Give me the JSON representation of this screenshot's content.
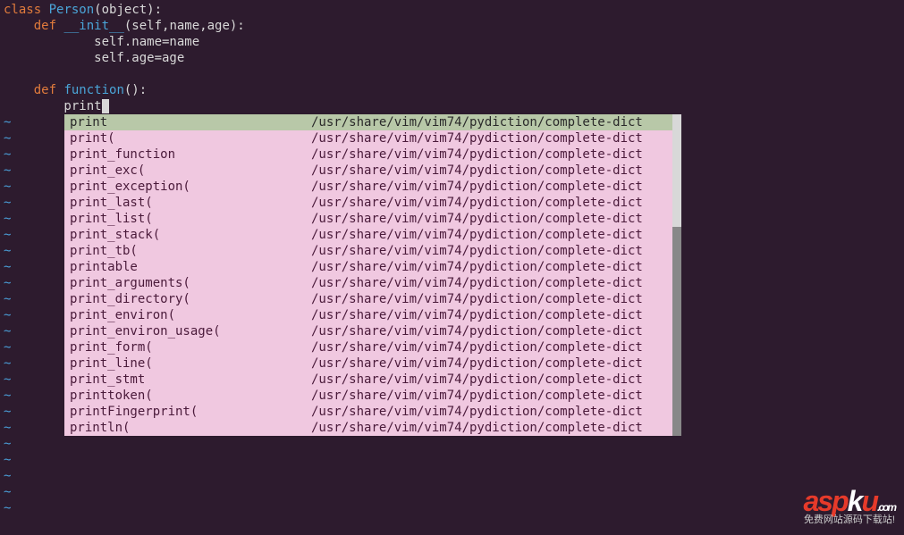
{
  "code": {
    "line1_class": "class",
    "line1_name": " Person",
    "line1_paren": "(object):",
    "line2_def": "    def",
    "line2_name": " __init__",
    "line2_paren": "(self,name,age):",
    "line3": "            self.name=name",
    "line4": "            self.age=age",
    "line5": "",
    "line6_def": "    def",
    "line6_name": " function",
    "line6_paren": "():",
    "line7": "        print"
  },
  "popup": {
    "items": [
      {
        "word": "print",
        "file": "/usr/share/vim/vim74/pydiction/complete-dict",
        "selected": true
      },
      {
        "word": "print(",
        "file": "/usr/share/vim/vim74/pydiction/complete-dict",
        "selected": false
      },
      {
        "word": "print_function",
        "file": "/usr/share/vim/vim74/pydiction/complete-dict",
        "selected": false
      },
      {
        "word": "print_exc(",
        "file": "/usr/share/vim/vim74/pydiction/complete-dict",
        "selected": false
      },
      {
        "word": "print_exception(",
        "file": "/usr/share/vim/vim74/pydiction/complete-dict",
        "selected": false
      },
      {
        "word": "print_last(",
        "file": "/usr/share/vim/vim74/pydiction/complete-dict",
        "selected": false
      },
      {
        "word": "print_list(",
        "file": "/usr/share/vim/vim74/pydiction/complete-dict",
        "selected": false
      },
      {
        "word": "print_stack(",
        "file": "/usr/share/vim/vim74/pydiction/complete-dict",
        "selected": false
      },
      {
        "word": "print_tb(",
        "file": "/usr/share/vim/vim74/pydiction/complete-dict",
        "selected": false
      },
      {
        "word": "printable",
        "file": "/usr/share/vim/vim74/pydiction/complete-dict",
        "selected": false
      },
      {
        "word": "print_arguments(",
        "file": "/usr/share/vim/vim74/pydiction/complete-dict",
        "selected": false
      },
      {
        "word": "print_directory(",
        "file": "/usr/share/vim/vim74/pydiction/complete-dict",
        "selected": false
      },
      {
        "word": "print_environ(",
        "file": "/usr/share/vim/vim74/pydiction/complete-dict",
        "selected": false
      },
      {
        "word": "print_environ_usage(",
        "file": "/usr/share/vim/vim74/pydiction/complete-dict",
        "selected": false
      },
      {
        "word": "print_form(",
        "file": "/usr/share/vim/vim74/pydiction/complete-dict",
        "selected": false
      },
      {
        "word": "print_line(",
        "file": "/usr/share/vim/vim74/pydiction/complete-dict",
        "selected": false
      },
      {
        "word": "print_stmt",
        "file": "/usr/share/vim/vim74/pydiction/complete-dict",
        "selected": false
      },
      {
        "word": "printtoken(",
        "file": "/usr/share/vim/vim74/pydiction/complete-dict",
        "selected": false
      },
      {
        "word": "printFingerprint(",
        "file": "/usr/share/vim/vim74/pydiction/complete-dict",
        "selected": false
      },
      {
        "word": "println(",
        "file": "/usr/share/vim/vim74/pydiction/complete-dict",
        "selected": false
      }
    ]
  },
  "tilde": "~",
  "watermark": {
    "logo_a": "asp",
    "logo_k": "k",
    "logo_u": "u",
    "logo_com": ".com",
    "subtitle": "免费网站源码下载站!"
  }
}
